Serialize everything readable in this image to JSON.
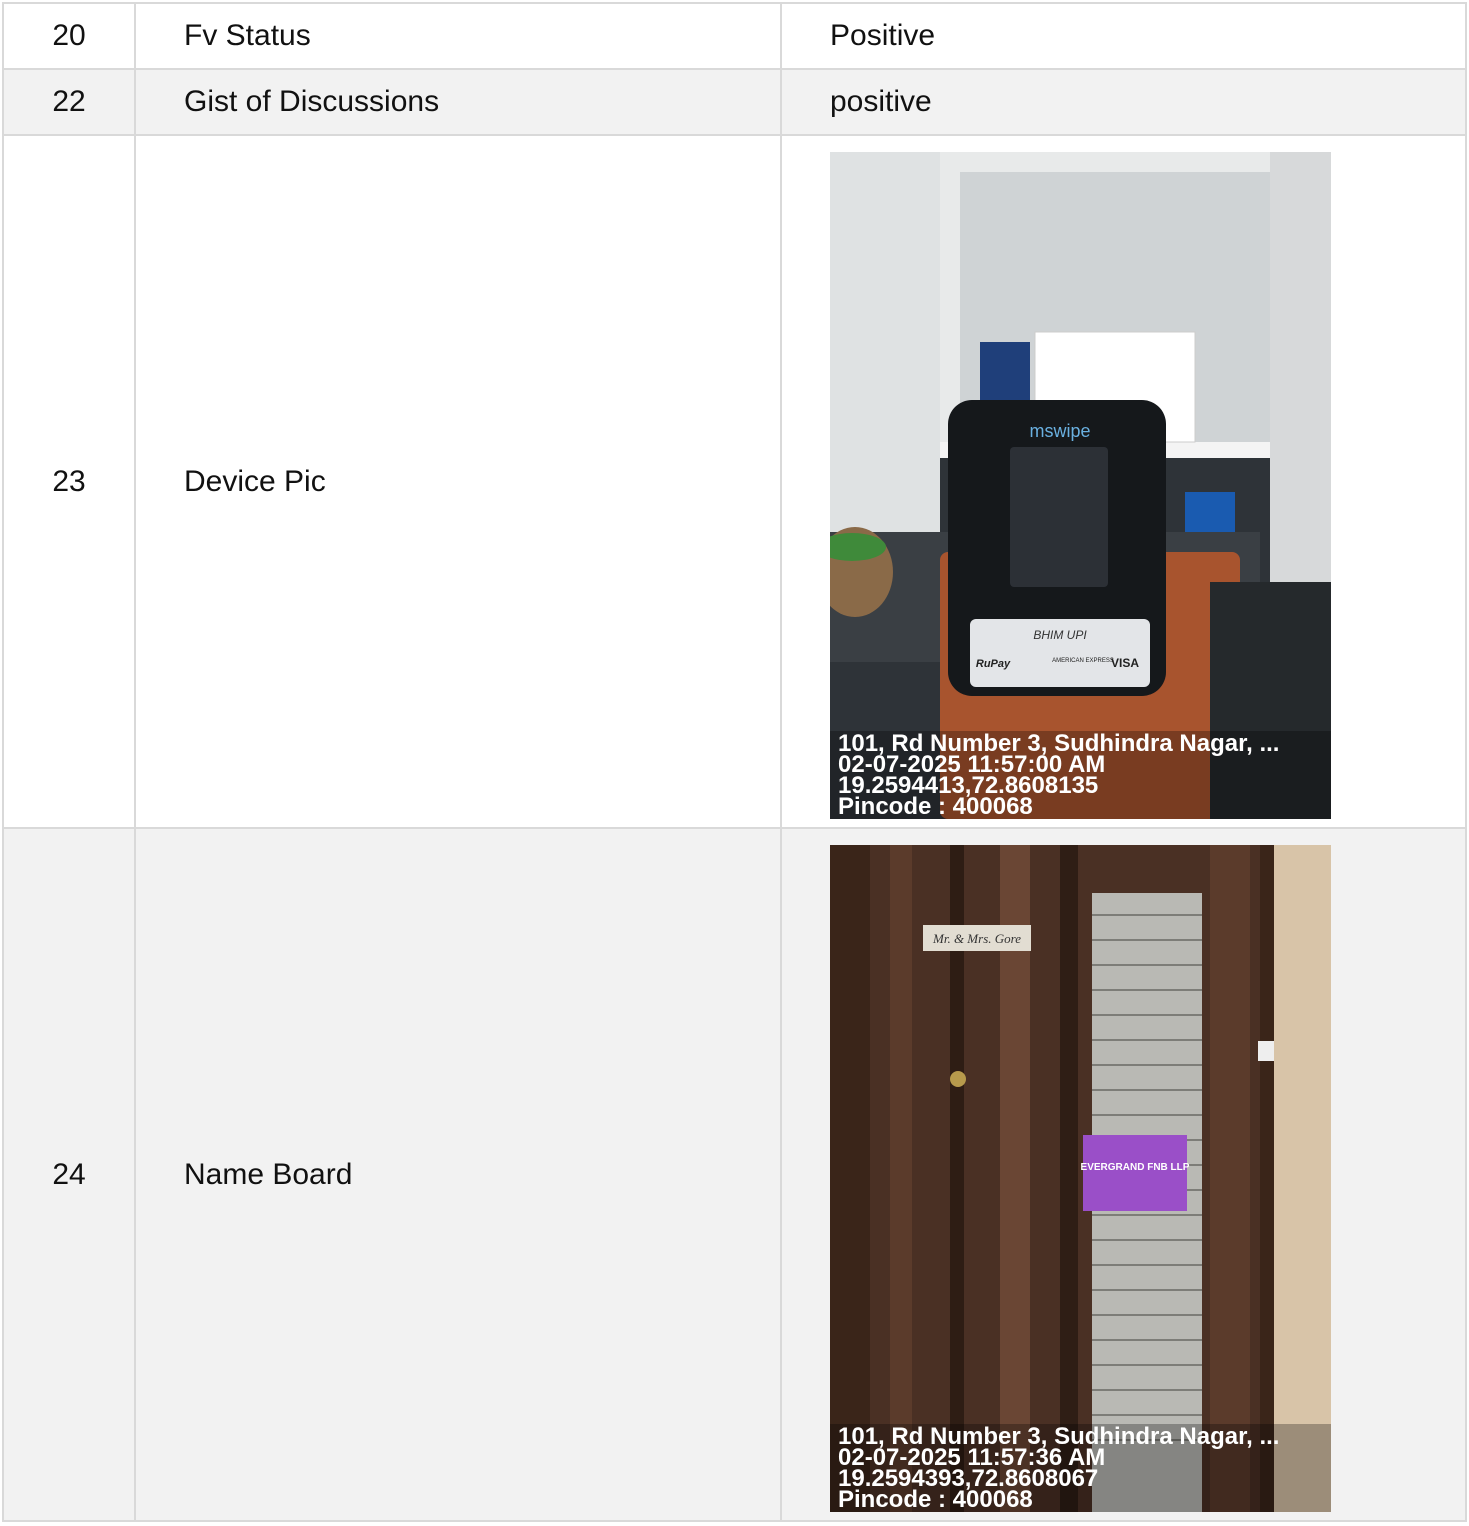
{
  "rows": [
    {
      "num": "20",
      "label": "Fv Status",
      "value": "Positive"
    },
    {
      "num": "22",
      "label": "Gist of Discussions",
      "value": "positive"
    },
    {
      "num": "23",
      "label": "Device Pic",
      "photo": {
        "device_brand": "mswipe",
        "device_text_1": "BHIM UPI",
        "device_text_2": "RuPay",
        "device_text_3": "AMERICAN EXPRESS",
        "device_text_4": "VISA",
        "address": "101, Rd Number 3, Sudhindra Nagar, ...",
        "datetime": "02-07-2025 11:57:00 AM",
        "coords": "19.2594413,72.8608135",
        "pincode": "Pincode : 400068"
      }
    },
    {
      "num": "24",
      "label": "Name Board",
      "photo": {
        "nameplate": "Mr. & Mrs. Gore",
        "board_title": "EVERGRAND FNB LLP",
        "address": "101, Rd Number 3, Sudhindra Nagar, ...",
        "datetime": "02-07-2025 11:57:36 AM",
        "coords": "19.2594393,72.8608067",
        "pincode": "Pincode : 400068"
      }
    }
  ],
  "colors": {
    "border": "#d9d9d9",
    "alt_row": "#f2f2f2"
  }
}
